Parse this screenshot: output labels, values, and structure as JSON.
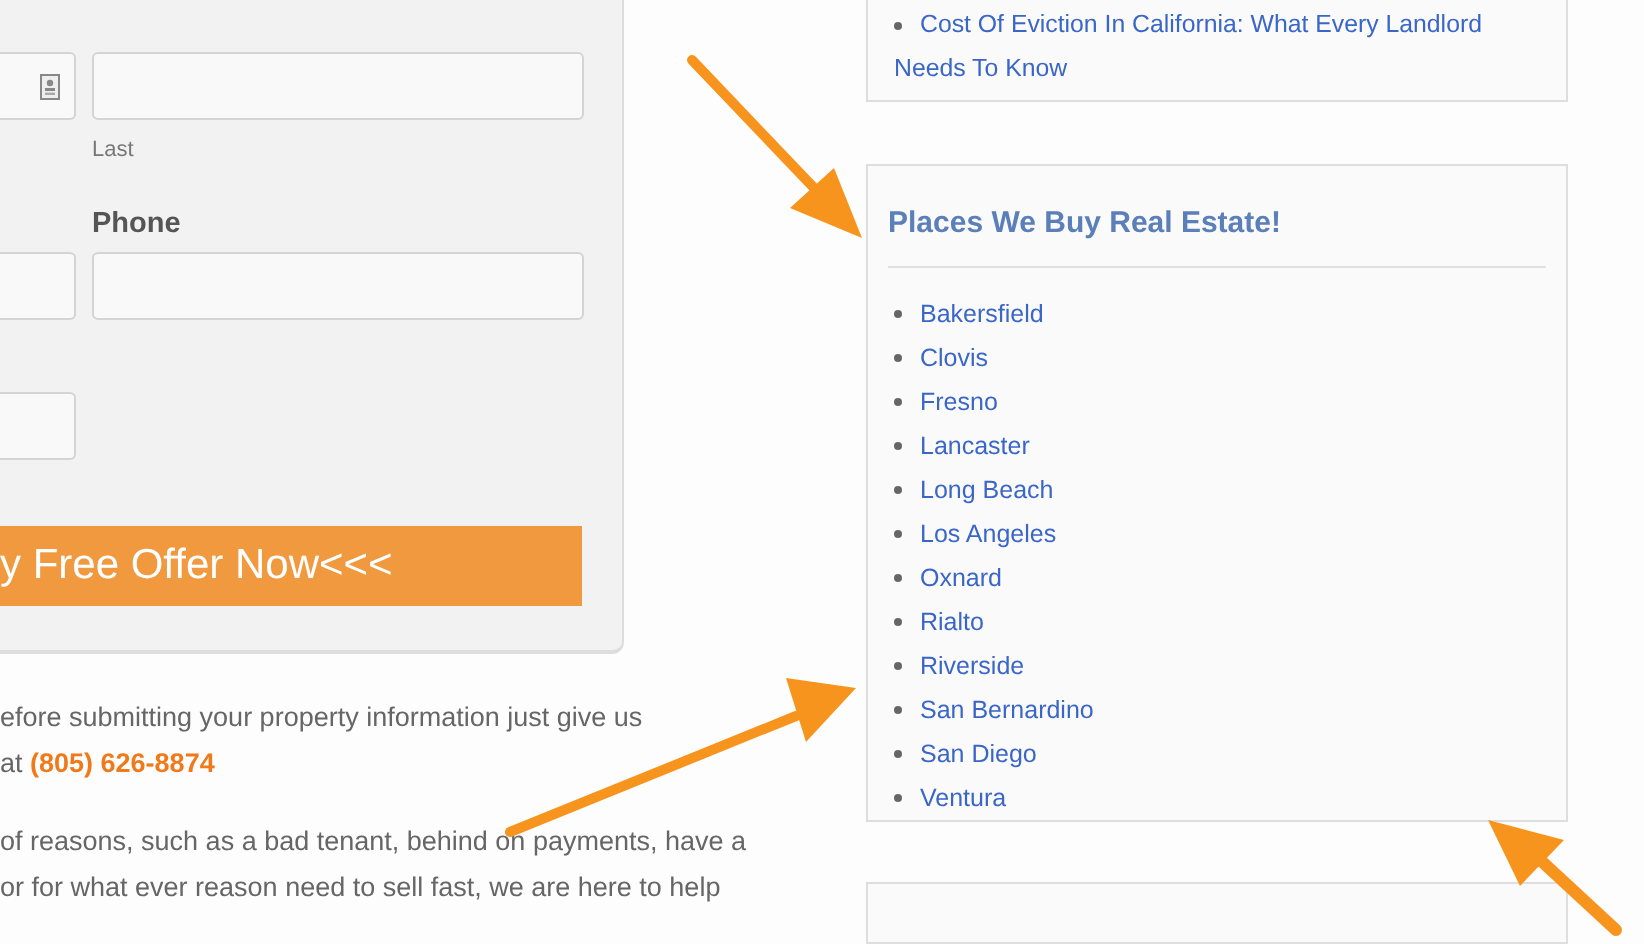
{
  "form": {
    "name_sublabel": "Last",
    "phone_label": "Phone",
    "submit_button": "y Free Offer Now<<<"
  },
  "intro": {
    "lines": [
      "efore submitting your property information just give us",
      "at **(805) 626-8874**"
    ]
  },
  "body_text": {
    "lines": [
      "of reasons, such as a bad tenant, behind on payments, have a",
      "or for what ever reason need to sell fast, we are here to help"
    ]
  },
  "recent_posts": {
    "items": [
      "Cost Of Eviction In California: What Every Landlord Needs To Know"
    ]
  },
  "places_widget": {
    "title": "Places We Buy Real Estate!",
    "items": [
      "Bakersfield",
      "Clovis",
      "Fresno",
      "Lancaster",
      "Long Beach",
      "Los Angeles",
      "Oxnard",
      "Rialto",
      "Riverside",
      "San Bernardino",
      "San Diego",
      "Ventura"
    ]
  }
}
